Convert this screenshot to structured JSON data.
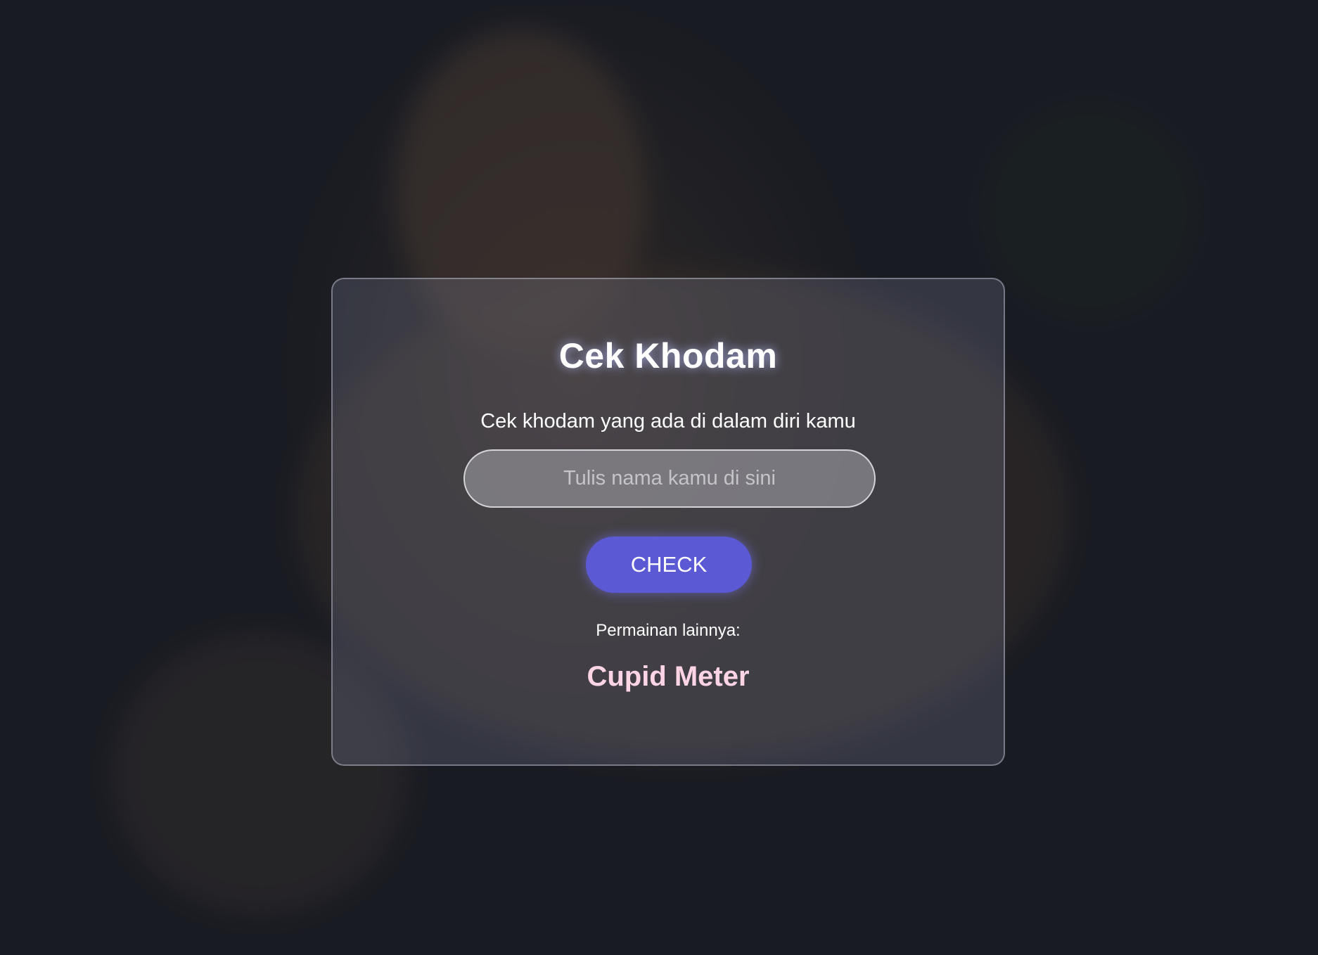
{
  "card": {
    "title": "Cek Khodam",
    "subtitle": "Cek khodam yang ada di dalam diri kamu",
    "input": {
      "placeholder": "Tulis nama kamu di sini",
      "value": ""
    },
    "check_button_label": "CHECK",
    "other_games_label": "Permainan lainnya:",
    "other_game_link": "Cupid Meter"
  },
  "colors": {
    "button": "#5b59d4",
    "link": "#ffd4e4",
    "page_background": "#1f2129"
  },
  "background": {
    "image_subject": "tiger"
  }
}
